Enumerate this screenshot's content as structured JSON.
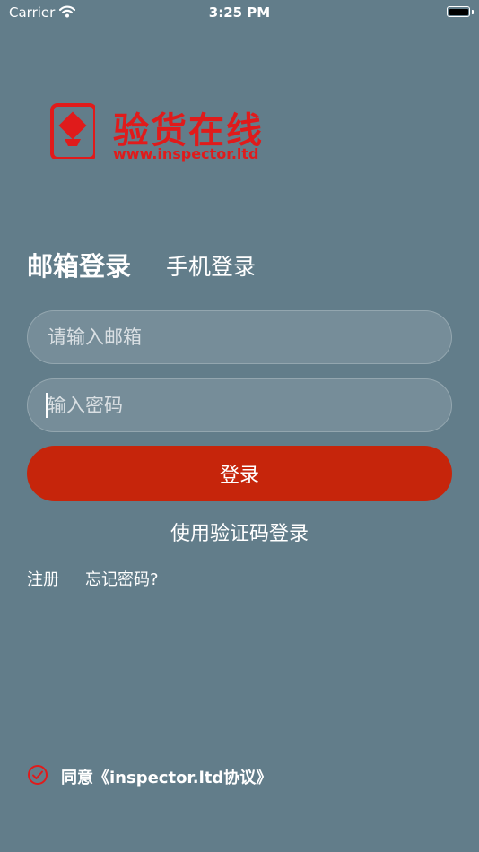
{
  "status_bar": {
    "carrier": "Carrier",
    "time": "3:25 PM",
    "icons": [
      "wifi-icon",
      "battery-icon"
    ]
  },
  "logo": {
    "name": "验货在线",
    "url": "www.inspector.ltd",
    "color": "#e01b1b"
  },
  "tabs": {
    "email": "邮箱登录",
    "phone": "手机登录",
    "active": "email"
  },
  "form": {
    "email_placeholder": "请输入邮箱",
    "email_value": "",
    "password_placeholder": "输入密码",
    "password_value": "",
    "login_label": "登录",
    "code_login": "使用验证码登录",
    "register": "注册",
    "forgot": "忘记密码?"
  },
  "agreement": {
    "text": "同意《inspector.ltd协议》",
    "checked": true,
    "icon": "check-circle-icon"
  },
  "colors": {
    "background": "#627d8a",
    "accent": "#c6250b",
    "check": "#e01b1b"
  }
}
